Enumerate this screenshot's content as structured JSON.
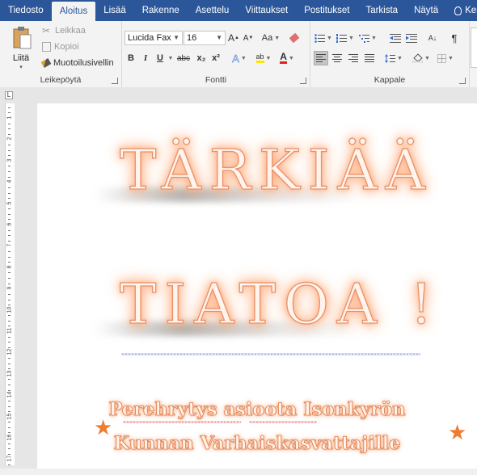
{
  "tabs": [
    "Tiedosto",
    "Aloitus",
    "Lisää",
    "Rakenne",
    "Asettelu",
    "Viittaukset",
    "Postitukset",
    "Tarkista",
    "Näytä",
    "Ker"
  ],
  "active_tab": "Aloitus",
  "clipboard": {
    "paste_label": "Liitä",
    "cut_label": "Leikkaa",
    "copy_label": "Kopioi",
    "format_painter_label": "Muotoilusivellin",
    "group_label": "Leikepöytä"
  },
  "font": {
    "family": "Lucida Fax",
    "size": "16",
    "grow": "A",
    "shrink": "A",
    "case": "Aa",
    "bold": "B",
    "italic": "I",
    "underline": "U",
    "strike": "abc",
    "subscript": "x₂",
    "superscript": "x²",
    "effects": "A",
    "highlight": "ab",
    "color": "A",
    "group_label": "Fontti"
  },
  "paragraph": {
    "group_label": "Kappale",
    "pilcrow": "¶",
    "sort": "A↓"
  },
  "ruler": {
    "tab_selector": "L",
    "numbers": [
      "1",
      "2",
      "3",
      "4",
      "5",
      "6",
      "7",
      "8",
      "9",
      "10",
      "11",
      "12",
      "13",
      "14",
      "15",
      "16",
      "17"
    ]
  },
  "document": {
    "line1": "TÄRKIÄÄ",
    "line2": "TIATOA !",
    "sub1": "Perehrytys asioota Isonkyrön",
    "sub2": "Kunnan Varhaiskasvattajille",
    "star": "★"
  },
  "colors": {
    "tab_bar": "#2b579a",
    "ribbon": "#f3f3f3",
    "text_glow": "#ff9a60",
    "star": "#ed7d31"
  }
}
